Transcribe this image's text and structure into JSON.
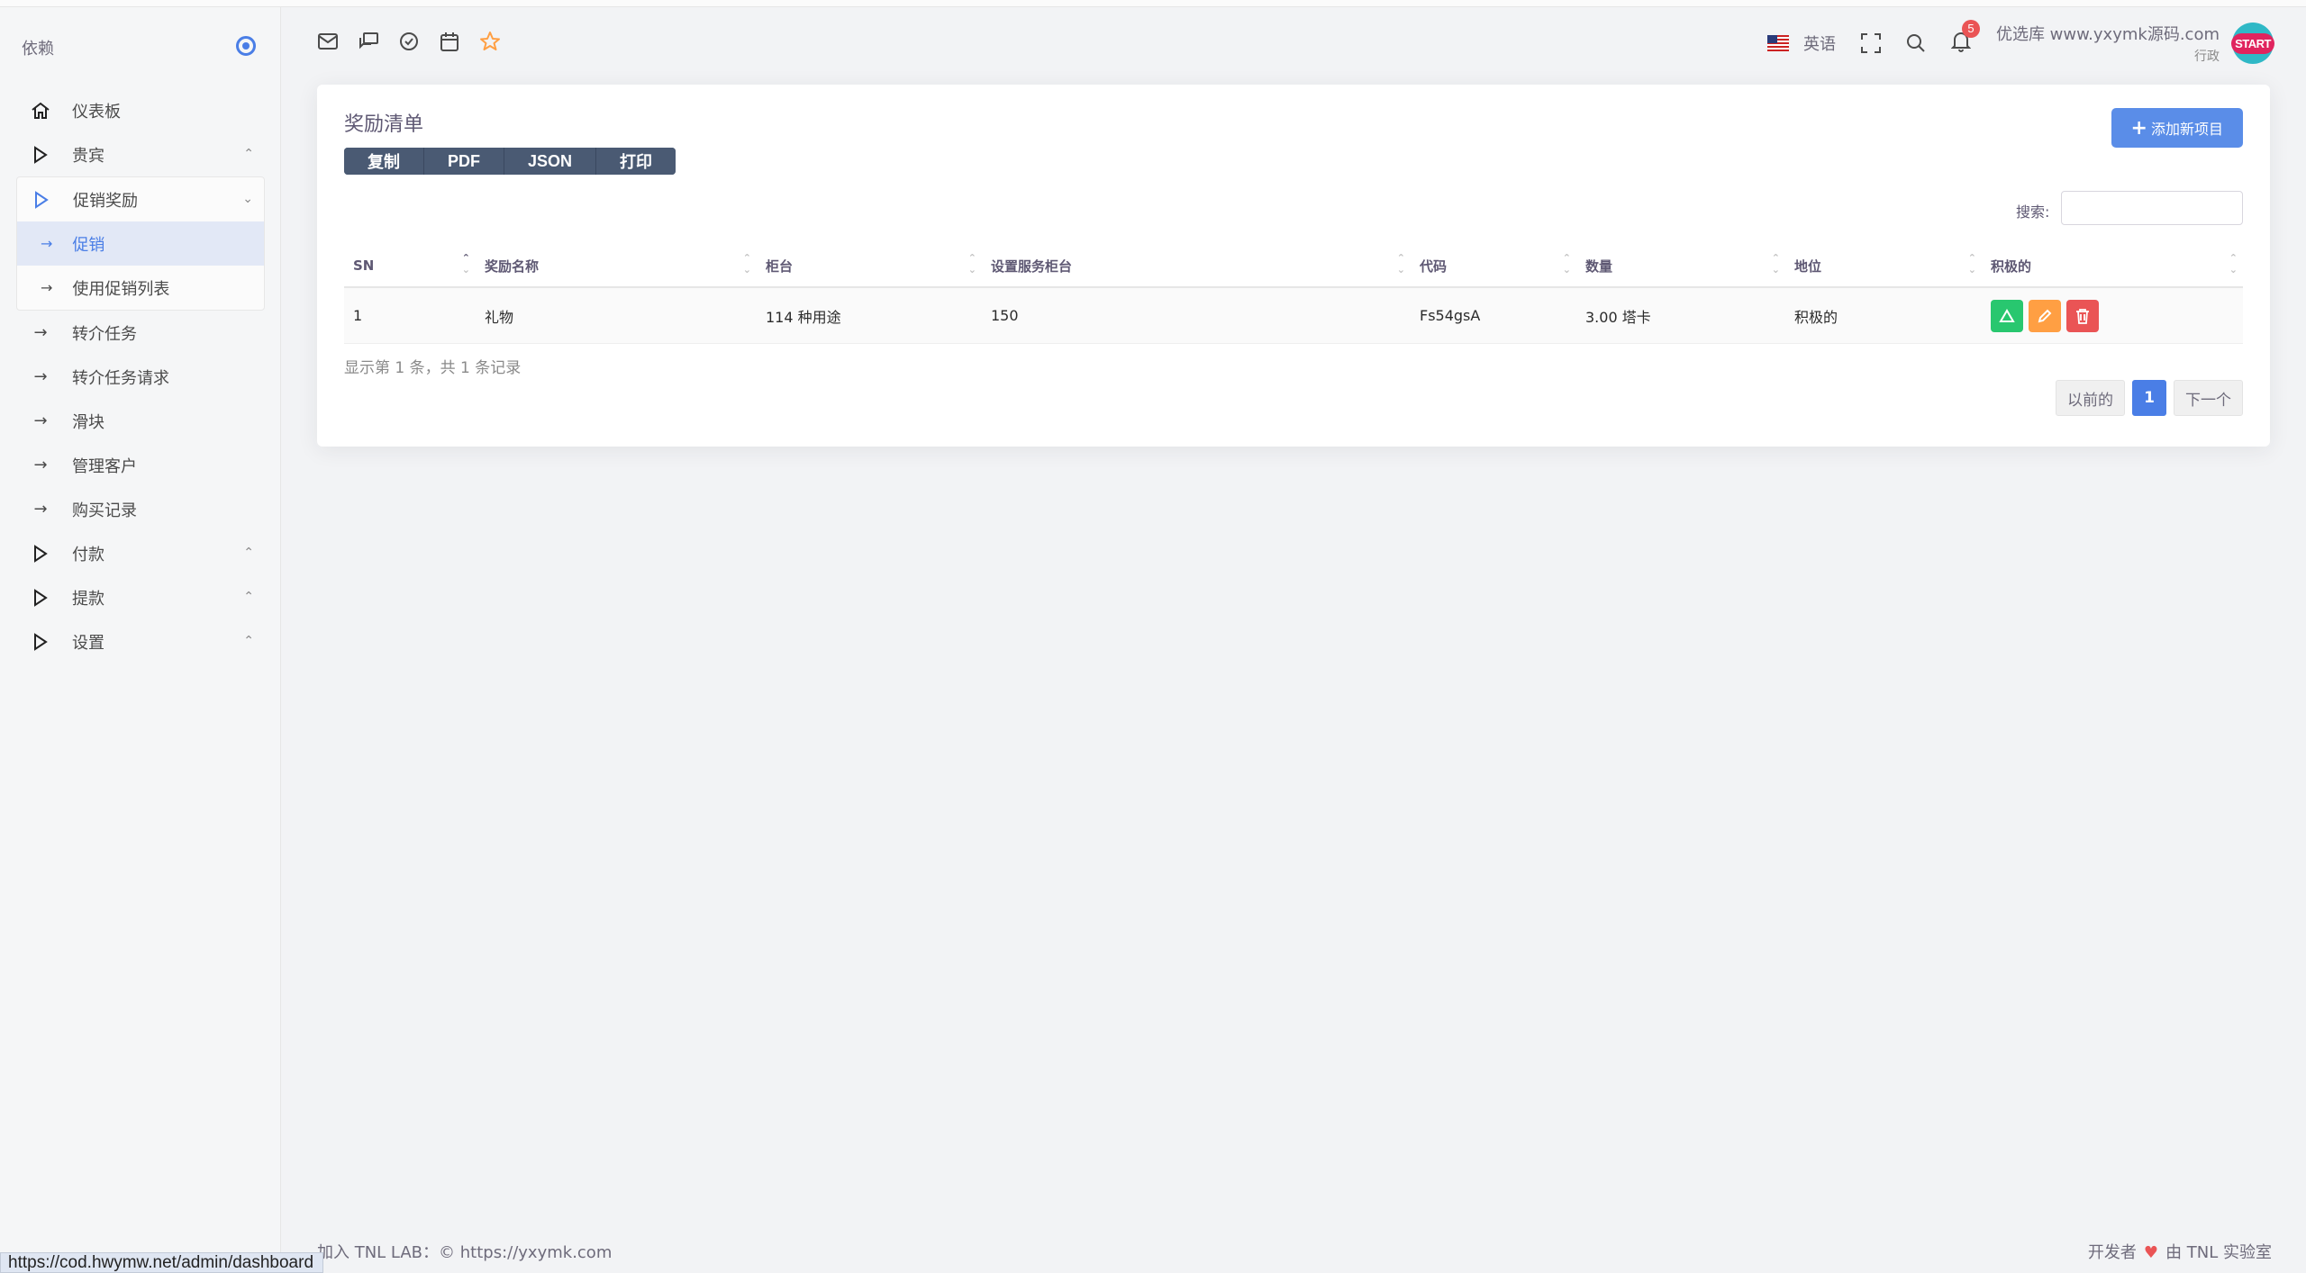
{
  "sidebar": {
    "brand": "依赖",
    "items": [
      {
        "label": "仪表板",
        "icon": "home-icon"
      },
      {
        "label": "贵宾",
        "icon": "play-icon",
        "chevron": "^"
      },
      {
        "label": "促销奖励",
        "icon": "play-icon",
        "chevron": "v",
        "open": true,
        "children": [
          {
            "label": "促销",
            "active": true
          },
          {
            "label": "使用促销列表"
          }
        ]
      },
      {
        "label": "转介任务",
        "icon": "arrow-right-icon"
      },
      {
        "label": "转介任务请求",
        "icon": "arrow-right-icon"
      },
      {
        "label": "滑块",
        "icon": "arrow-right-icon"
      },
      {
        "label": "管理客户",
        "icon": "arrow-right-icon"
      },
      {
        "label": "购买记录",
        "icon": "arrow-right-icon"
      },
      {
        "label": "付款",
        "icon": "play-icon",
        "chevron": "^"
      },
      {
        "label": "提款",
        "icon": "play-icon",
        "chevron": "^"
      },
      {
        "label": "设置",
        "icon": "play-icon",
        "chevron": "^"
      }
    ]
  },
  "header": {
    "icons": [
      "mail-icon",
      "chat-icon",
      "check-circle-icon",
      "calendar-icon",
      "star-icon"
    ],
    "language": "英语",
    "notification_count": "5",
    "user_name": "优选库 www.yxymk源码.com",
    "user_role": "行政",
    "avatar_text": "START"
  },
  "card": {
    "title": "奖励清单",
    "export_buttons": [
      "复制",
      "PDF",
      "JSON",
      "打印"
    ],
    "add_button": "添加新项目",
    "search_label": "搜索:",
    "search_value": "",
    "columns": [
      "SN",
      "奖励名称",
      "柜台",
      "设置服务柜台",
      "代码",
      "数量",
      "地位",
      "积极的"
    ],
    "rows": [
      {
        "sn": "1",
        "name": "礼物",
        "counter": "114 种用途",
        "service_counter": "150",
        "code": "Fs54gsA",
        "amount": "3.00 塔卡",
        "status": "积极的"
      }
    ],
    "info": "显示第 1 条，共 1 条记录",
    "pagination": {
      "prev": "以前的",
      "current": "1",
      "next": "下一个"
    }
  },
  "footer": {
    "left": "加入 TNL LAB：© https://yxymk.com",
    "right_prefix": "开发者",
    "right_suffix": "由 TNL 实验室"
  },
  "status_url": "https://cod.hwymw.net/admin/dashboard",
  "colors": {
    "accent": "#4a7ee6",
    "primary_button": "#5a8de8",
    "success": "#28c76f",
    "warning": "#ff9f43",
    "danger": "#ea5455",
    "export_group": "#4a5a73"
  }
}
